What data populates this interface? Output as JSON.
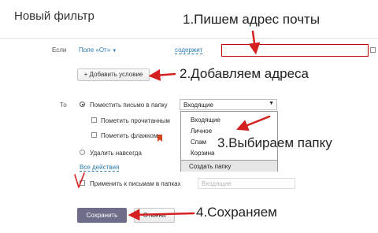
{
  "header": {
    "title": "Новый фильтр"
  },
  "condition": {
    "if_label": "Если",
    "field": "Поле «От»",
    "operator": "содержит",
    "value": ""
  },
  "add_condition_label": "+ Добавить условие",
  "action": {
    "to_label": "То",
    "move_label": "Поместить письмо в папку",
    "folder_selected": "Входящие",
    "mark_read_label": "Пометить прочитанным",
    "mark_flag_label": "Пометить флажком",
    "delete_label": "Удалить навсегда",
    "all_actions_link": "Все действия"
  },
  "dropdown": {
    "options": [
      "Входящие",
      "Личное",
      "Спам",
      "Корзина"
    ],
    "create_folder": "Создать папку"
  },
  "apply": {
    "label": "Применить к письмам в папках",
    "folder": "Входящие"
  },
  "buttons": {
    "save": "Сохранить",
    "cancel": "Отмена"
  },
  "annotations": {
    "step1": "1.Пишем адрес почты",
    "step2": "2.Добавляем адреса",
    "step3": "3.Выбираем папку",
    "step4": "4.Сохраняем"
  },
  "colors": {
    "arrow": "#d42020",
    "save_button": "#6e6e8a",
    "link": "#2a7ab0",
    "flag": "#d2451e"
  }
}
